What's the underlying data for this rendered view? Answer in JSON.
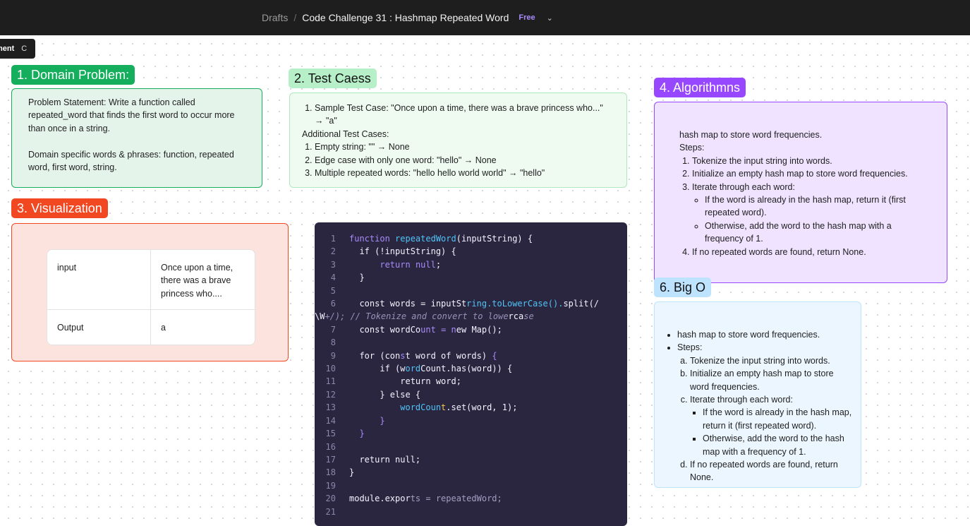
{
  "header": {
    "left_glyph": ")",
    "breadcrumb_parent": "Drafts",
    "separator": "/",
    "file_title": "Code Challenge 31 : Hashmap Repeated Word",
    "plan_badge": "Free",
    "dropdown_icon": "chevron-down-icon"
  },
  "tooltip": {
    "text": "ment",
    "shortcut": "C"
  },
  "domain": {
    "label": "1. Domain Problem:",
    "problem_statement": "Problem Statement: Write a function called repeated_word that finds the first word to occur more than once in a string.",
    "domain_words": "Domain specific words & phrases: function, repeated word, first word, string."
  },
  "tests": {
    "label": "2. Test Caess",
    "sample": "Sample Test Case: \"Once upon a time, there was a brave princess who...\" → \"a\"",
    "additional_heading": "Additional Test Cases:",
    "additional": [
      "Empty string: \"\" → None",
      "Edge case with only one word: \"hello\" → None",
      "Multiple repeated words: \"hello hello world world\" → \"hello\""
    ]
  },
  "visualization": {
    "label": "3. Visualization",
    "rows": [
      {
        "key": "input",
        "value": "Once upon a time, there was a brave princess who...."
      },
      {
        "key": "Output",
        "value": "a"
      }
    ]
  },
  "code": {
    "line_numbers": [
      "1",
      "2",
      "3",
      "4",
      "5",
      "6",
      "",
      "7",
      "8",
      "9",
      "10",
      "11",
      "12",
      "13",
      "14",
      "15",
      "16",
      "17",
      "18",
      "19",
      "20",
      "21"
    ],
    "lines": [
      "function repeatedWord(inputString) {",
      "  if (!inputString) {",
      "      return null;",
      "  }",
      "",
      "  const words = inputString.toLowerCase().split(/",
      "\\W+/); // Tokenize and convert to lowercase",
      "  const wordCount = new Map();",
      "",
      "  for (const word of words) {",
      "      if (wordCount.has(word)) {",
      "          return word;",
      "      } else {",
      "          wordCount.set(word, 1);",
      "      }",
      "  }",
      "",
      "  return null;",
      "}",
      "",
      "module.exports = repeatedWord;",
      ""
    ]
  },
  "algorithms": {
    "label": "4. Algorithmns",
    "intro": "hash map to store word frequencies.",
    "steps_heading": "Steps:",
    "steps": [
      "Tokenize the input string into words.",
      "Initialize an empty hash map to store word frequencies.",
      "Iterate through each word:",
      "If no repeated words are found, return None."
    ],
    "substeps": [
      "If the word is already in the hash map, return it (first repeated word).",
      "Otherwise, add the word to the hash map with a frequency of 1."
    ]
  },
  "bigo": {
    "label": "6. Big O",
    "bullets": [
      "hash map to store word frequencies.",
      "Steps:"
    ],
    "steps": [
      "Tokenize the input string into words.",
      "Initialize an empty hash map to store word frequencies.",
      "Iterate through each word:",
      "If no repeated words are found, return None."
    ],
    "substeps": [
      "If the word is already in the hash map, return it (first repeated word).",
      "Otherwise, add the word to the hash map with a frequency of 1."
    ]
  },
  "colors": {
    "green": "#14ae5c",
    "light_green": "#b6efc8",
    "red": "#f24822",
    "purple": "#9747ff",
    "light_blue": "#bde3ff",
    "code_bg": "#2b2640"
  }
}
